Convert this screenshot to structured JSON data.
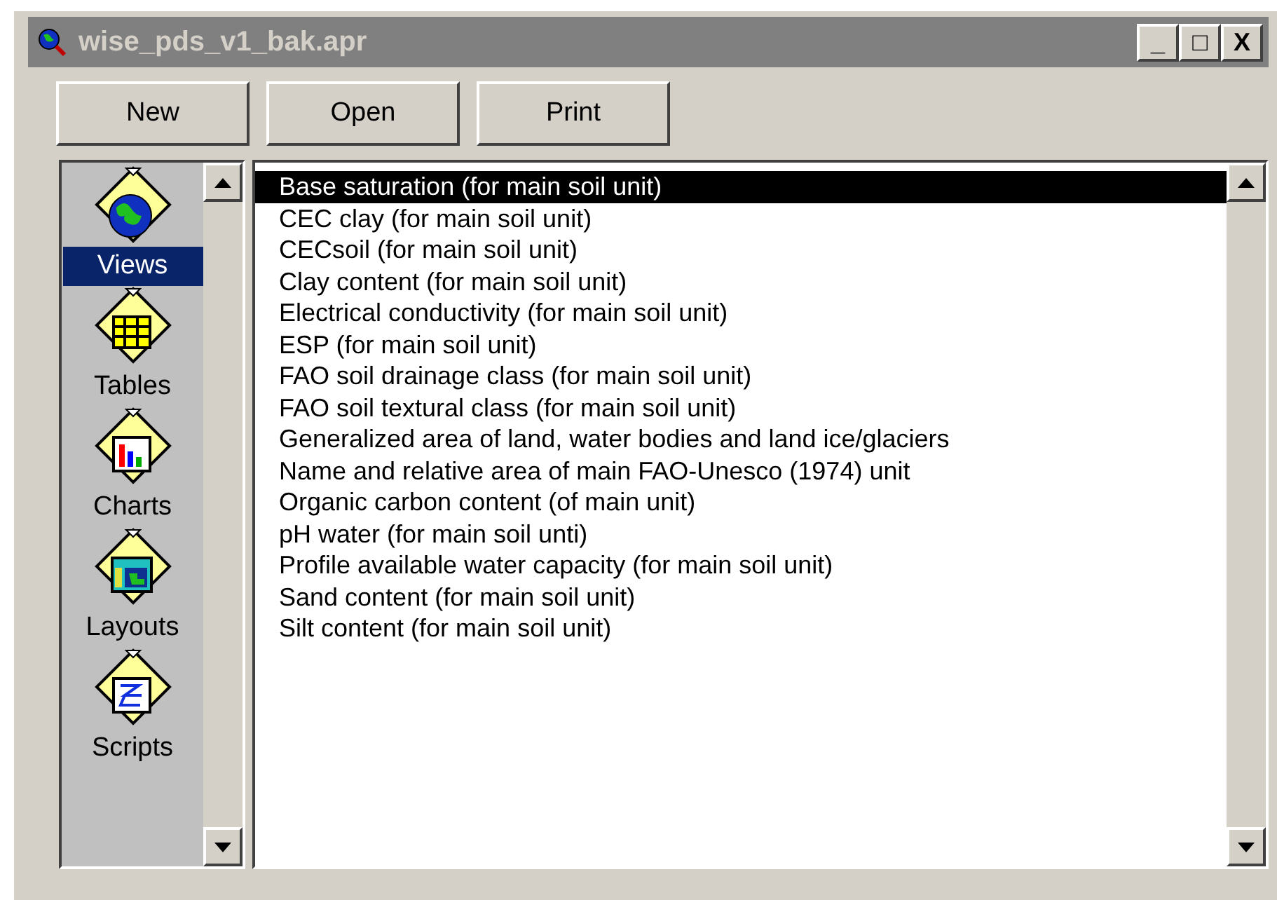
{
  "window": {
    "title": "wise_pds_v1_bak.apr",
    "controls": [
      "_",
      "□",
      "X"
    ]
  },
  "buttons": [
    "New",
    "Open",
    "Print"
  ],
  "sidebar": {
    "items": [
      {
        "label": "Views",
        "kind": "views",
        "selected": true
      },
      {
        "label": "Tables",
        "kind": "tables",
        "selected": false
      },
      {
        "label": "Charts",
        "kind": "charts",
        "selected": false
      },
      {
        "label": "Layouts",
        "kind": "layouts",
        "selected": false
      },
      {
        "label": "Scripts",
        "kind": "scripts",
        "selected": false
      }
    ]
  },
  "list": {
    "items": [
      {
        "label": "Base saturation (for main soil unit)",
        "selected": true
      },
      {
        "label": "CEC clay (for main soil unit)",
        "selected": false
      },
      {
        "label": "CECsoil (for main soil unit)",
        "selected": false
      },
      {
        "label": "Clay content (for main soil unit)",
        "selected": false
      },
      {
        "label": "Electrical conductivity (for main soil unit)",
        "selected": false
      },
      {
        "label": "ESP (for main soil unit)",
        "selected": false
      },
      {
        "label": "FAO soil drainage class (for main soil unit)",
        "selected": false
      },
      {
        "label": "FAO soil textural class (for main soil unit)",
        "selected": false
      },
      {
        "label": "Generalized area of land, water bodies and land ice/glaciers",
        "selected": false
      },
      {
        "label": "Name and relative area of main FAO-Unesco (1974) unit",
        "selected": false
      },
      {
        "label": "Organic carbon content (of main unit)",
        "selected": false
      },
      {
        "label": "pH water (for main soil unti)",
        "selected": false
      },
      {
        "label": "Profile available water capacity (for main soil unit)",
        "selected": false
      },
      {
        "label": "Sand content (for main soil unit)",
        "selected": false
      },
      {
        "label": "Silt content (for main soil unit)",
        "selected": false
      }
    ]
  }
}
